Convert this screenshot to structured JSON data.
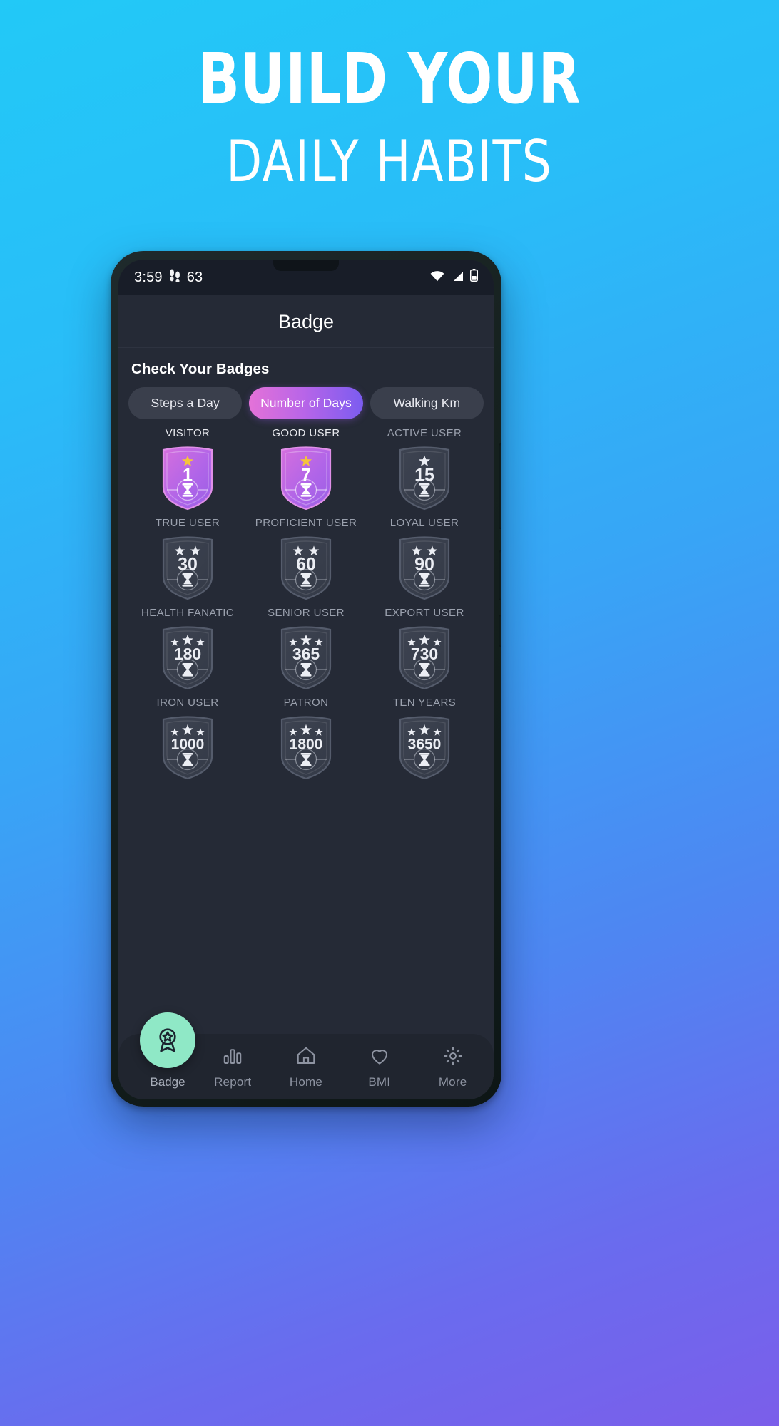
{
  "hero": {
    "line1": "BUILD YOUR",
    "line2": "DAILY HABITS"
  },
  "colors": {
    "bg_start": "#22c9f7",
    "bg_end": "#7b5eea",
    "accent_pill_start": "#e472d8",
    "accent_pill_end": "#7b5cf0",
    "fab": "#8fe8c6",
    "screen_bg": "#252a36",
    "star_gold": "#f5c43a"
  },
  "status_bar": {
    "time": "3:59",
    "steps_icon": "footsteps-icon",
    "step_count": "63",
    "wifi_icon": "wifi-icon",
    "signal_icon": "cellular-signal-icon",
    "battery_icon": "battery-icon"
  },
  "app_bar": {
    "title": "Badge"
  },
  "main": {
    "section_title": "Check Your Badges",
    "tabs": [
      {
        "label": "Steps a Day",
        "active": false
      },
      {
        "label": "Number of Days",
        "active": true
      },
      {
        "label": "Walking Km",
        "active": false
      }
    ],
    "badges": [
      {
        "label": "VISITOR",
        "value": "1",
        "stars": 1,
        "unlocked": true
      },
      {
        "label": "GOOD USER",
        "value": "7",
        "stars": 1,
        "unlocked": true
      },
      {
        "label": "ACTIVE USER",
        "value": "15",
        "stars": 1,
        "unlocked": false
      },
      {
        "label": "TRUE USER",
        "value": "30",
        "stars": 2,
        "unlocked": false
      },
      {
        "label": "PROFICIENT USER",
        "value": "60",
        "stars": 2,
        "unlocked": false
      },
      {
        "label": "LOYAL USER",
        "value": "90",
        "stars": 2,
        "unlocked": false
      },
      {
        "label": "HEALTH FANATIC",
        "value": "180",
        "stars": 3,
        "unlocked": false
      },
      {
        "label": "SENIOR USER",
        "value": "365",
        "stars": 3,
        "unlocked": false
      },
      {
        "label": "EXPORT USER",
        "value": "730",
        "stars": 3,
        "unlocked": false
      },
      {
        "label": "IRON USER",
        "value": "1000",
        "stars": 3,
        "unlocked": false
      },
      {
        "label": "PATRON",
        "value": "1800",
        "stars": 3,
        "unlocked": false
      },
      {
        "label": "TEN YEARS",
        "value": "3650",
        "stars": 3,
        "unlocked": false
      }
    ],
    "badge_inner_icon": "hourglass-icon"
  },
  "bottom_nav": {
    "items": [
      {
        "label": "Badge",
        "icon": "award-ribbon-icon",
        "active": true
      },
      {
        "label": "Report",
        "icon": "bar-chart-icon",
        "active": false
      },
      {
        "label": "Home",
        "icon": "home-icon",
        "active": false
      },
      {
        "label": "BMI",
        "icon": "heart-icon",
        "active": false
      },
      {
        "label": "More",
        "icon": "gear-icon",
        "active": false
      }
    ]
  }
}
